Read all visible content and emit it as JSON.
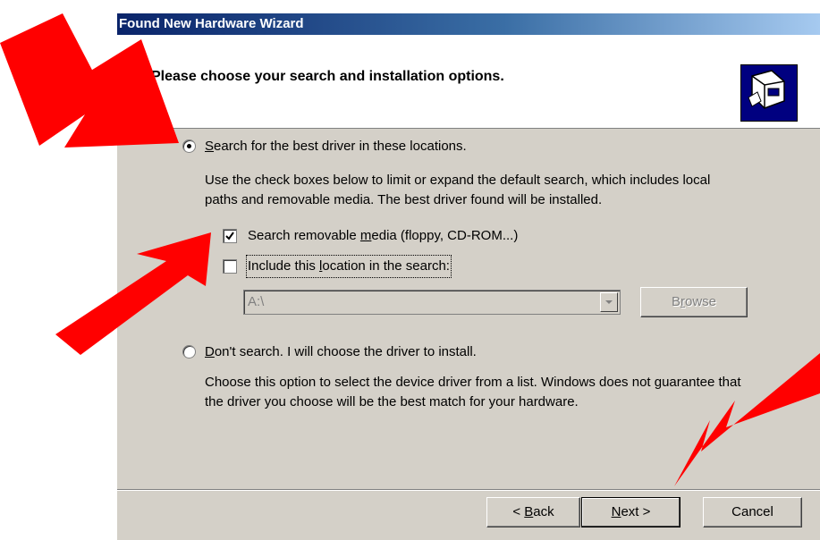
{
  "window": {
    "title": "Found New Hardware Wizard"
  },
  "header": {
    "heading": "Please choose your search and installation options."
  },
  "option_search": {
    "label_first": "S",
    "label_rest": "earch for the best driver in these locations.",
    "selected": true,
    "description_line1": "Use the check boxes below to limit or expand the default search, which includes local",
    "description_line2": "paths and removable media. The best driver found will be installed."
  },
  "check_removable": {
    "label_pre": "Search removable ",
    "label_key": "m",
    "label_post": "edia (floppy, CD-ROM...)",
    "checked": true
  },
  "check_location": {
    "label_pre": "Include this ",
    "label_key": "l",
    "label_post": "ocation in the search:",
    "checked": false
  },
  "location": {
    "value": "A:\\"
  },
  "browse_button": {
    "label_pre": "B",
    "label_key": "r",
    "label_post": "owse"
  },
  "option_dont_search": {
    "label_first": "D",
    "label_rest": "on't search. I will choose the driver to install.",
    "selected": false,
    "description_line1": "Choose this option to select the device driver from a list.  Windows does not guarantee that",
    "description_line2": "the driver you choose will be the best match for your hardware."
  },
  "footer": {
    "back_pre": "< ",
    "back_key": "B",
    "back_post": "ack",
    "next_key": "N",
    "next_post": "ext >",
    "cancel": "Cancel"
  },
  "colors": {
    "dialog_bg": "#d4d0c8",
    "title_start": "#0a246a",
    "annotation": "#ff0000"
  },
  "icons": [
    "hardware-wizard-icon",
    "radio-button",
    "checkbox",
    "dropdown-arrow-icon",
    "red-annotation-arrow"
  ]
}
